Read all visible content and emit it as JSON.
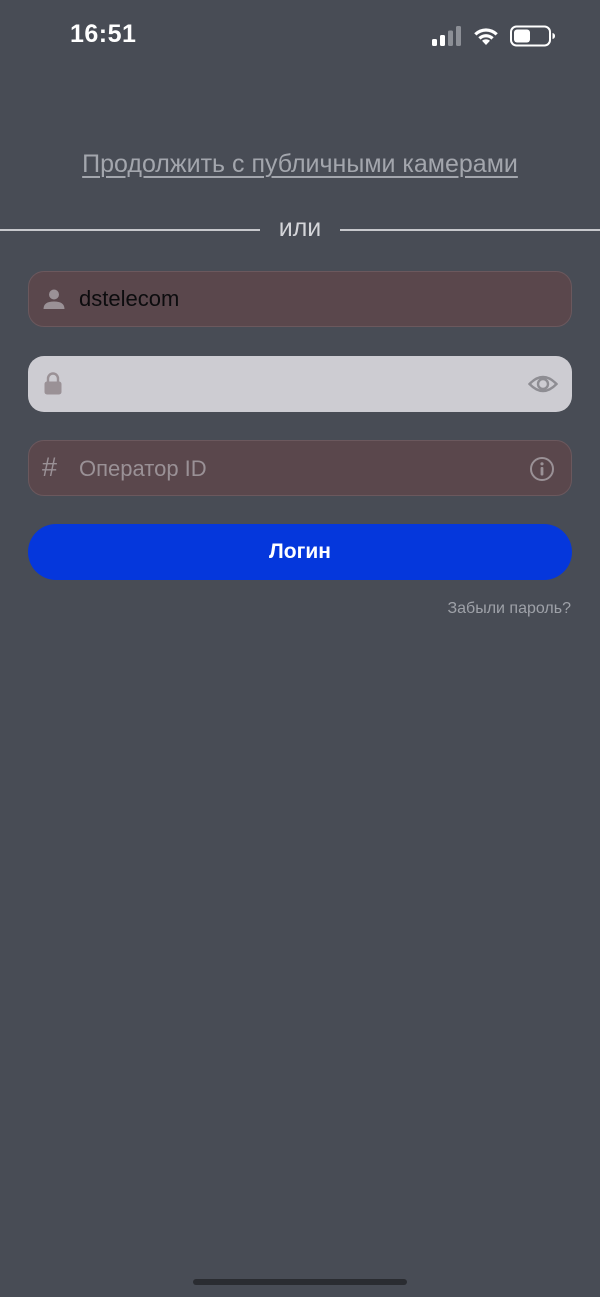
{
  "status_bar": {
    "time": "16:51",
    "signal_icon": "cellular-signal-icon",
    "wifi_icon": "wifi-icon",
    "battery_icon": "battery-icon"
  },
  "public_link": {
    "label": "Продолжить с публичными камерами"
  },
  "divider": {
    "label": "или"
  },
  "form": {
    "username": {
      "icon": "user-icon",
      "value": "dstelecom"
    },
    "password": {
      "icon": "lock-icon",
      "value": "",
      "toggle_icon": "eye-icon"
    },
    "operator": {
      "icon": "hash-icon",
      "icon_glyph": "#",
      "placeholder": "Оператор ID",
      "info_icon": "info-icon"
    }
  },
  "login_button": {
    "label": "Логин"
  },
  "forgot_password": {
    "label": "Забыли пароль?"
  },
  "colors": {
    "background": "#484c55",
    "accent": "#0537dc",
    "error_field": "#5a474c",
    "active_field": "#cdccd2"
  }
}
